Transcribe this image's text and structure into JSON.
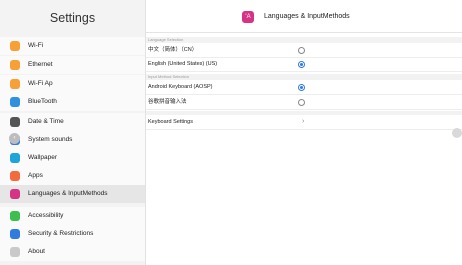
{
  "sidebar": {
    "title": "Settings",
    "items": [
      {
        "label": "Wi-Fi",
        "icon": "wifi-icon",
        "color": "#f7a035"
      },
      {
        "label": "Ethernet",
        "icon": "ethernet-icon",
        "color": "#f7a035"
      },
      {
        "label": "Wi-Fi Ap",
        "icon": "hotspot-icon",
        "color": "#f7a035"
      },
      {
        "label": "BlueTooth",
        "icon": "bluetooth-icon",
        "color": "#2f90e0"
      },
      {
        "label": "Date & Time",
        "icon": "clock-icon",
        "color": "#555555"
      },
      {
        "label": "System sounds",
        "icon": "sound-icon",
        "color": "#2f7be0"
      },
      {
        "label": "Wallpaper",
        "icon": "wallpaper-icon",
        "color": "#1fa3d8"
      },
      {
        "label": "Apps",
        "icon": "apps-icon",
        "color": "#f36b3b"
      },
      {
        "label": "Languages & InputMethods",
        "icon": "language-icon",
        "color": "#d63384"
      },
      {
        "label": "Accessibility",
        "icon": "accessibility-icon",
        "color": "#3dbf4f"
      },
      {
        "label": "Security & Restrictions",
        "icon": "security-icon",
        "color": "#2f7be0"
      },
      {
        "label": "About",
        "icon": "info-icon",
        "color": "#c9c9c9"
      }
    ]
  },
  "header": {
    "title": "Languages & InputMethods",
    "icon_text": "'A"
  },
  "sections": {
    "language": "Language Selection",
    "input": "Input Method Selection"
  },
  "languages": [
    {
      "label": "中文（简体）（CN）",
      "selected": false
    },
    {
      "label": "English (United States) (US)",
      "selected": true
    }
  ],
  "inputs": [
    {
      "label": "Android Keyboard (AOSP)",
      "selected": true
    },
    {
      "label": "谷歌拼音输入法",
      "selected": false
    }
  ],
  "keyboard": {
    "label": "Keyboard Settings",
    "chevron": "›"
  },
  "side_handle": "‹"
}
